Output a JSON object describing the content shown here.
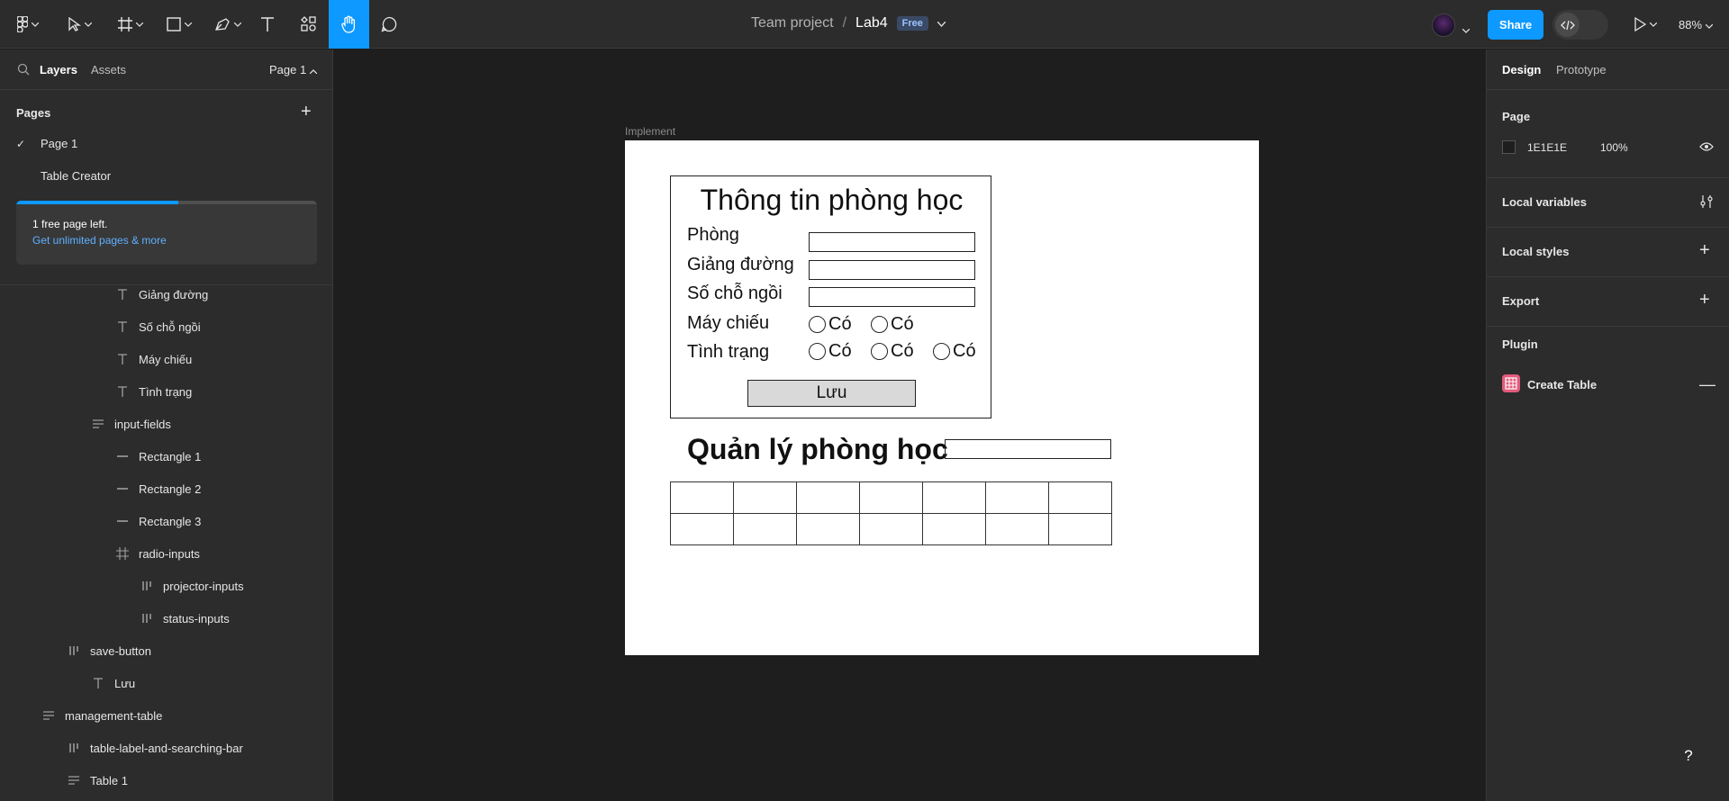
{
  "topbar": {
    "team": "Team project",
    "separator": "/",
    "file_name": "Lab4",
    "plan_badge": "Free",
    "share_label": "Share",
    "zoom": "88%"
  },
  "left_panel": {
    "tab_layers": "Layers",
    "tab_assets": "Assets",
    "page_selector": "Page 1",
    "pages_heading": "Pages",
    "pages": [
      "Page 1",
      "Table Creator"
    ],
    "promo_line1": "1 free page left.",
    "promo_line2": "Get unlimited pages & more",
    "promo_progress": 0.54,
    "layers": [
      {
        "name": "Giảng đường",
        "icon": "text-icon"
      },
      {
        "name": "Số chỗ ngồi",
        "icon": "text-icon"
      },
      {
        "name": "Máy chiếu",
        "icon": "text-icon"
      },
      {
        "name": "Tình trạng",
        "icon": "text-icon"
      },
      {
        "name": "input-fields",
        "icon": "vertical-stack-icon"
      },
      {
        "name": "Rectangle 1",
        "icon": "line-icon"
      },
      {
        "name": "Rectangle 2",
        "icon": "line-icon"
      },
      {
        "name": "Rectangle 3",
        "icon": "line-icon"
      },
      {
        "name": "radio-inputs",
        "icon": "frame-icon"
      },
      {
        "name": "projector-inputs",
        "icon": "horizontal-stack-icon"
      },
      {
        "name": "status-inputs",
        "icon": "horizontal-stack-icon"
      },
      {
        "name": "save-button",
        "icon": "horizontal-stack-icon"
      },
      {
        "name": "Lưu",
        "icon": "text-icon"
      },
      {
        "name": "management-table",
        "icon": "vertical-stack-icon"
      },
      {
        "name": "table-label-and-searching-bar",
        "icon": "horizontal-stack-icon"
      },
      {
        "name": "Table 1",
        "icon": "vertical-stack-icon"
      }
    ]
  },
  "canvas": {
    "frame_label": "Implement",
    "form_title": "Thông tin phòng học",
    "field_phong": "Phòng",
    "field_giang_duong": "Giảng đường",
    "field_so_cho": "Số chỗ ngồi",
    "field_may_chieu": "Máy chiếu",
    "field_tinh_trang": "Tình trạng",
    "radio_label": "Có",
    "save_label": "Lưu",
    "management_title": "Quản lý phòng học",
    "table_rows": 2,
    "table_cols": 7
  },
  "right_panel": {
    "tab_design": "Design",
    "tab_prototype": "Prototype",
    "page_heading": "Page",
    "page_color": "1E1E1E",
    "page_opacity": "100%",
    "local_variables": "Local variables",
    "local_styles": "Local styles",
    "export": "Export",
    "plugin_heading": "Plugin",
    "plugin_name": "Create Table"
  },
  "help_label": "?",
  "colors": {
    "accent": "#0d99ff",
    "panel": "#2c2c2c",
    "canvas": "#1e1e1e",
    "plugin": "#e15b7d"
  }
}
